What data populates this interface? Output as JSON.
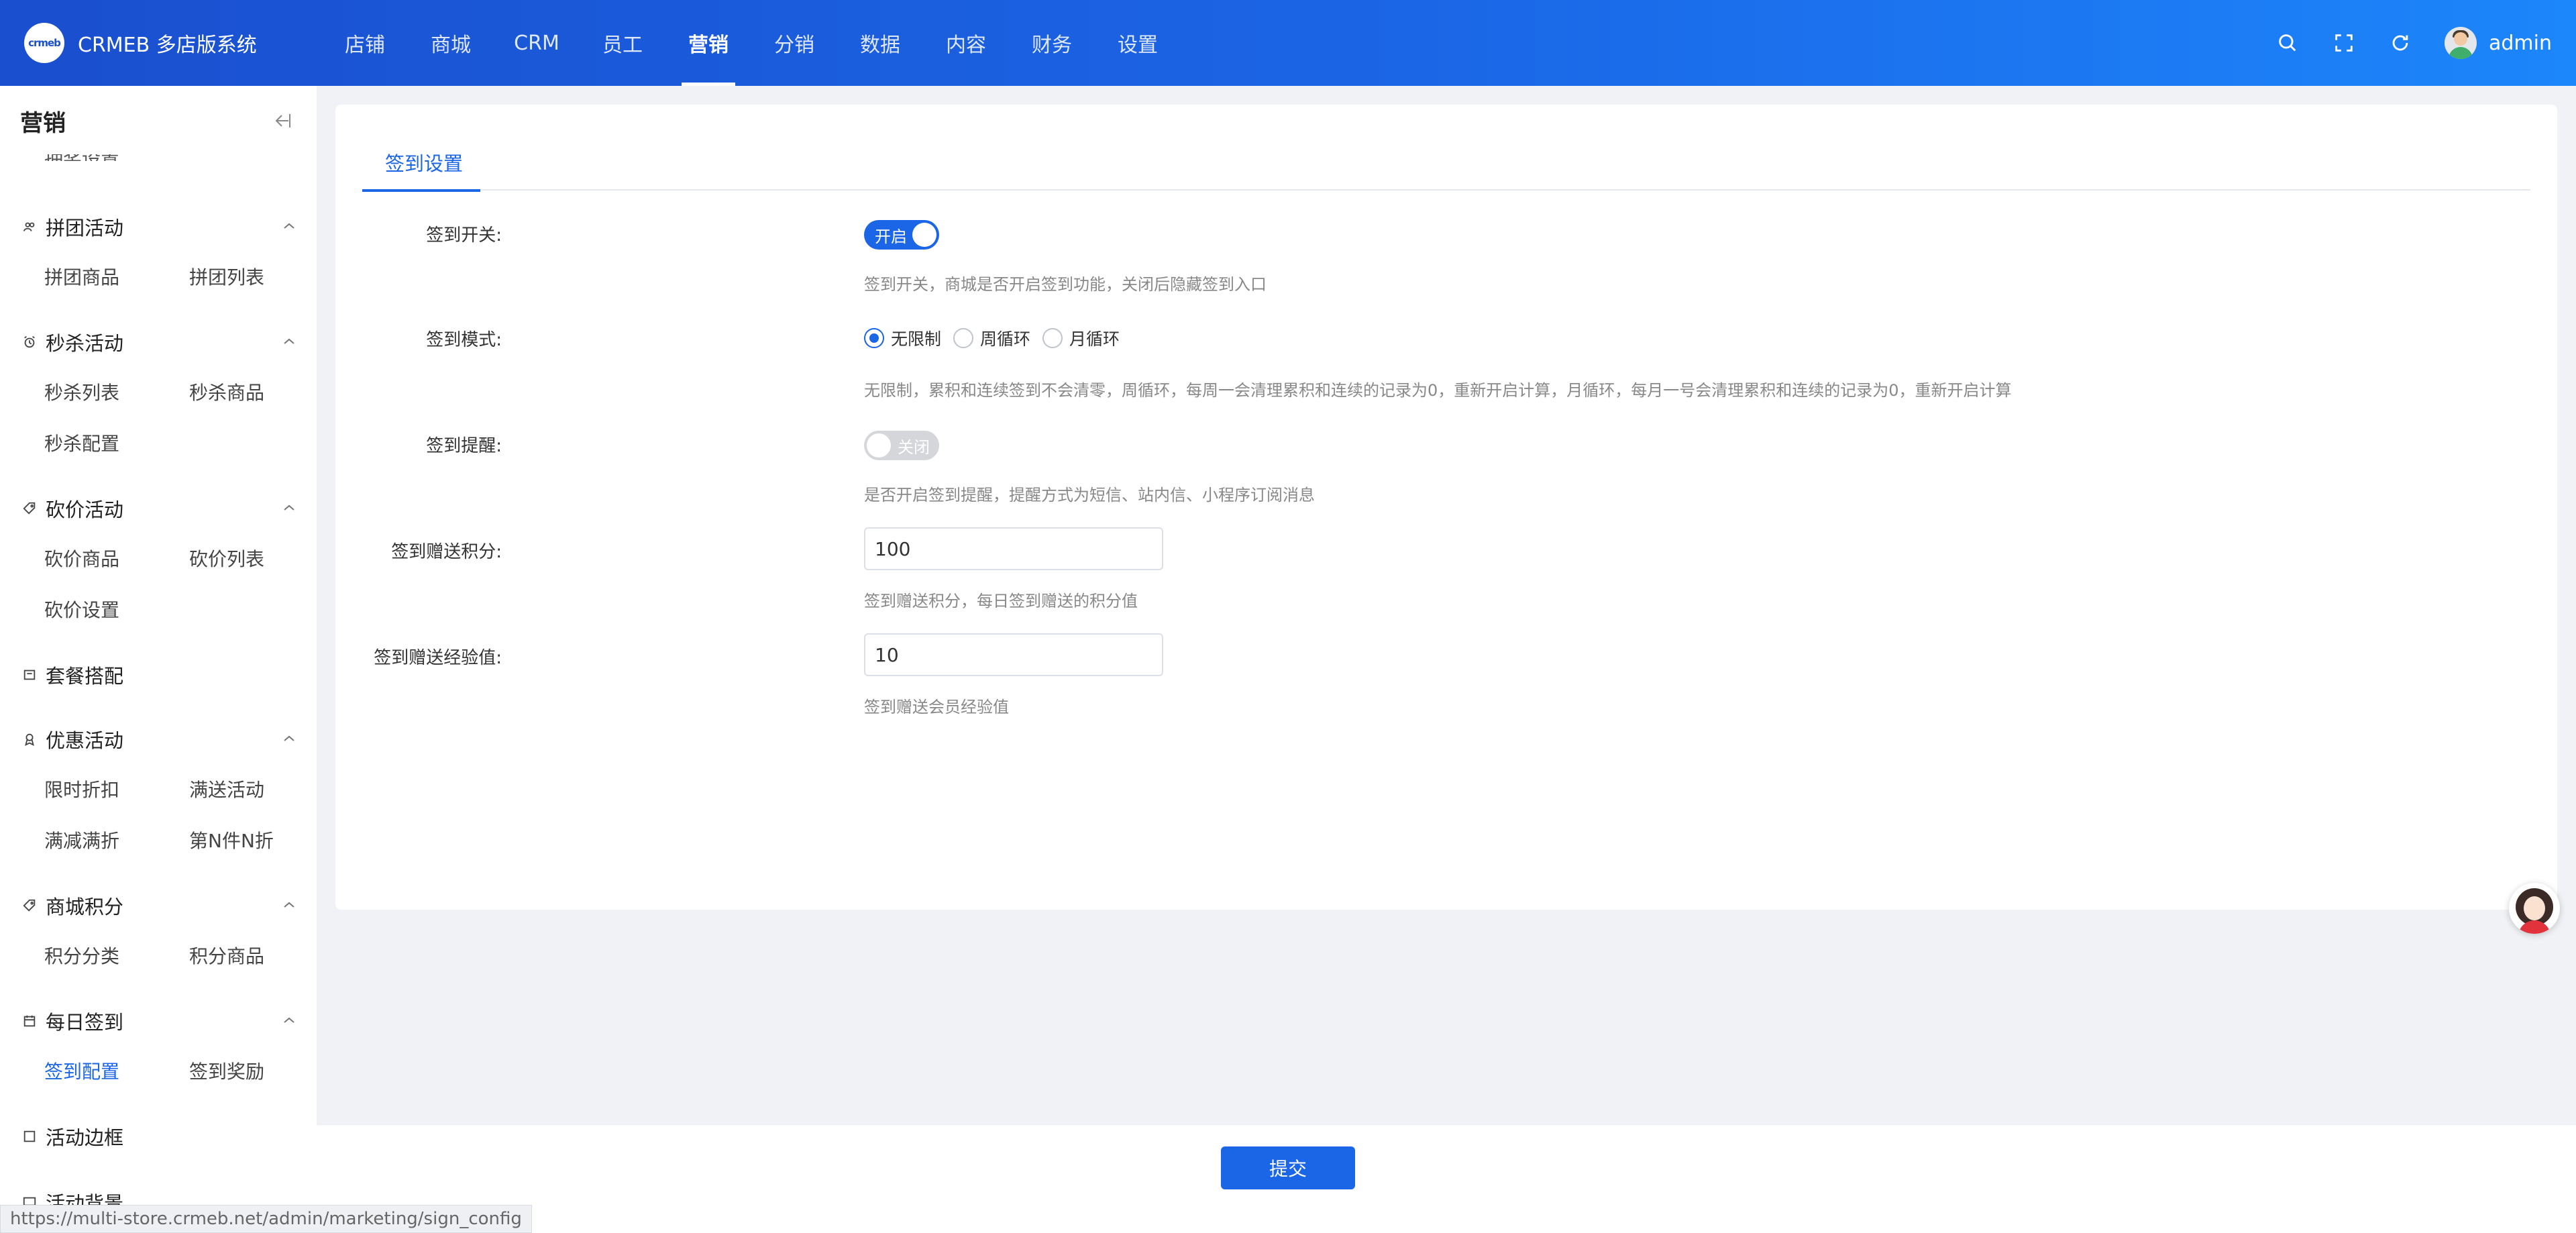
{
  "header": {
    "logo_text": "crmeb",
    "brand": "CRMEB 多店版系统",
    "nav": [
      "店铺",
      "商城",
      "CRM",
      "员工",
      "营销",
      "分销",
      "数据",
      "内容",
      "财务",
      "设置"
    ],
    "active_nav": "营销",
    "icons": [
      "search-icon",
      "fullscreen-icon",
      "refresh-icon"
    ],
    "user": "admin"
  },
  "sidebar": {
    "title": "营销",
    "clipped_item": "抽奖设置",
    "groups": [
      {
        "label": "拼团活动",
        "icon": "team-icon",
        "items": [
          "拼团商品",
          "拼团列表"
        ]
      },
      {
        "label": "秒杀活动",
        "icon": "alarm-clock-icon",
        "items": [
          "秒杀列表",
          "秒杀商品",
          "秒杀配置"
        ]
      },
      {
        "label": "砍价活动",
        "icon": "tag-icon",
        "items": [
          "砍价商品",
          "砍价列表",
          "砍价设置"
        ]
      },
      {
        "label": "套餐搭配",
        "icon": "package-icon",
        "items": []
      },
      {
        "label": "优惠活动",
        "icon": "badge-icon",
        "items": [
          "限时折扣",
          "满送活动",
          "满减满折",
          "第N件N折"
        ]
      },
      {
        "label": "商城积分",
        "icon": "points-tag-icon",
        "items": [
          "积分分类",
          "积分商品"
        ]
      },
      {
        "label": "每日签到",
        "icon": "calendar-icon",
        "items": [
          "签到配置",
          "签到奖励"
        ]
      },
      {
        "label": "活动边框",
        "icon": "frame-icon",
        "items": []
      },
      {
        "label": "活动背景",
        "icon": "background-icon",
        "items": []
      }
    ],
    "active_item": "签到配置"
  },
  "main": {
    "tab": "签到设置",
    "form": {
      "sign_switch": {
        "label": "签到开关:",
        "state_text": "开启",
        "on": true,
        "help": "签到开关，商城是否开启签到功能，关闭后隐藏签到入口"
      },
      "sign_mode": {
        "label": "签到模式:",
        "options": [
          "无限制",
          "周循环",
          "月循环"
        ],
        "selected": "无限制",
        "help": "无限制，累积和连续签到不会清零，周循环，每周一会清理累积和连续的记录为0，重新开启计算，月循环，每月一号会清理累积和连续的记录为0，重新开启计算"
      },
      "sign_remind": {
        "label": "签到提醒:",
        "state_text": "关闭",
        "on": false,
        "help": "是否开启签到提醒，提醒方式为短信、站内信、小程序订阅消息"
      },
      "sign_points": {
        "label": "签到赠送积分:",
        "value": "100",
        "help": "签到赠送积分，每日签到赠送的积分值"
      },
      "sign_exp": {
        "label": "签到赠送经验值:",
        "value": "10",
        "help": "签到赠送会员经验值"
      }
    },
    "submit_label": "提交"
  },
  "status_url": "https://multi-store.crmeb.net/admin/marketing/sign_config",
  "colors": {
    "primary": "#1b66e6",
    "header_start": "#1a4fcf",
    "header_end": "#1c86fb"
  }
}
